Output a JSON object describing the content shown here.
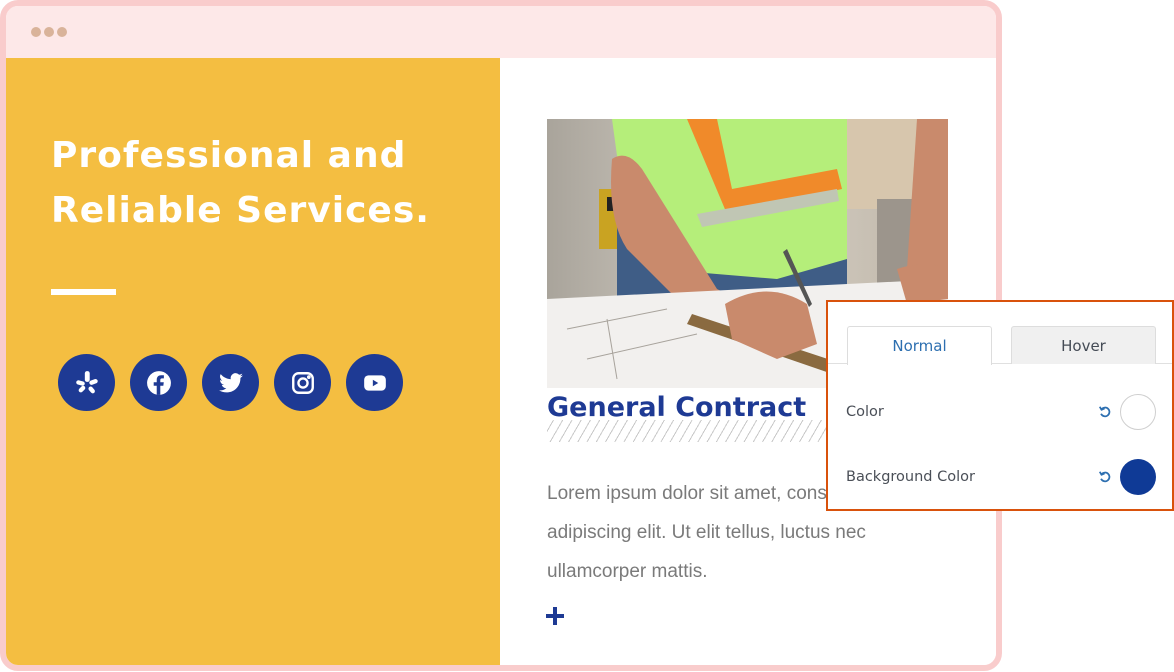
{
  "window": {
    "controls": [
      "dot",
      "dot",
      "dot"
    ]
  },
  "hero": {
    "headline_line1": "Professional and",
    "headline_line2": "Reliable Services.",
    "social_icons": [
      {
        "name": "yelp-icon",
        "label": "Yelp"
      },
      {
        "name": "facebook-icon",
        "label": "Facebook"
      },
      {
        "name": "twitter-icon",
        "label": "Twitter"
      },
      {
        "name": "instagram-icon",
        "label": "Instagram"
      },
      {
        "name": "youtube-icon",
        "label": "YouTube"
      }
    ]
  },
  "service": {
    "image_alt": "Construction worker in high-visibility vest drawing on blueprints",
    "title": "General Contract",
    "description": "Lorem ipsum dolor sit amet, consectetur adipiscing elit. Ut elit tellus, luctus nec ullamcorper mattis.",
    "expand_icon": "plus-icon"
  },
  "style_panel": {
    "tabs": [
      {
        "label": "Normal",
        "active": true
      },
      {
        "label": "Hover",
        "active": false
      }
    ],
    "rows": [
      {
        "label": "Color",
        "value": "#ffffff",
        "reset_icon": "reset-icon"
      },
      {
        "label": "Background Color",
        "value": "#0f3a96",
        "reset_icon": "reset-icon"
      }
    ]
  },
  "colors": {
    "frame": "#f9cccc",
    "titlebar": "#fde8e8",
    "hero_background": "#f4be41",
    "brand_blue": "#1e3a94",
    "panel_border": "#d9520c",
    "tab_active_text": "#2d6fb0"
  }
}
